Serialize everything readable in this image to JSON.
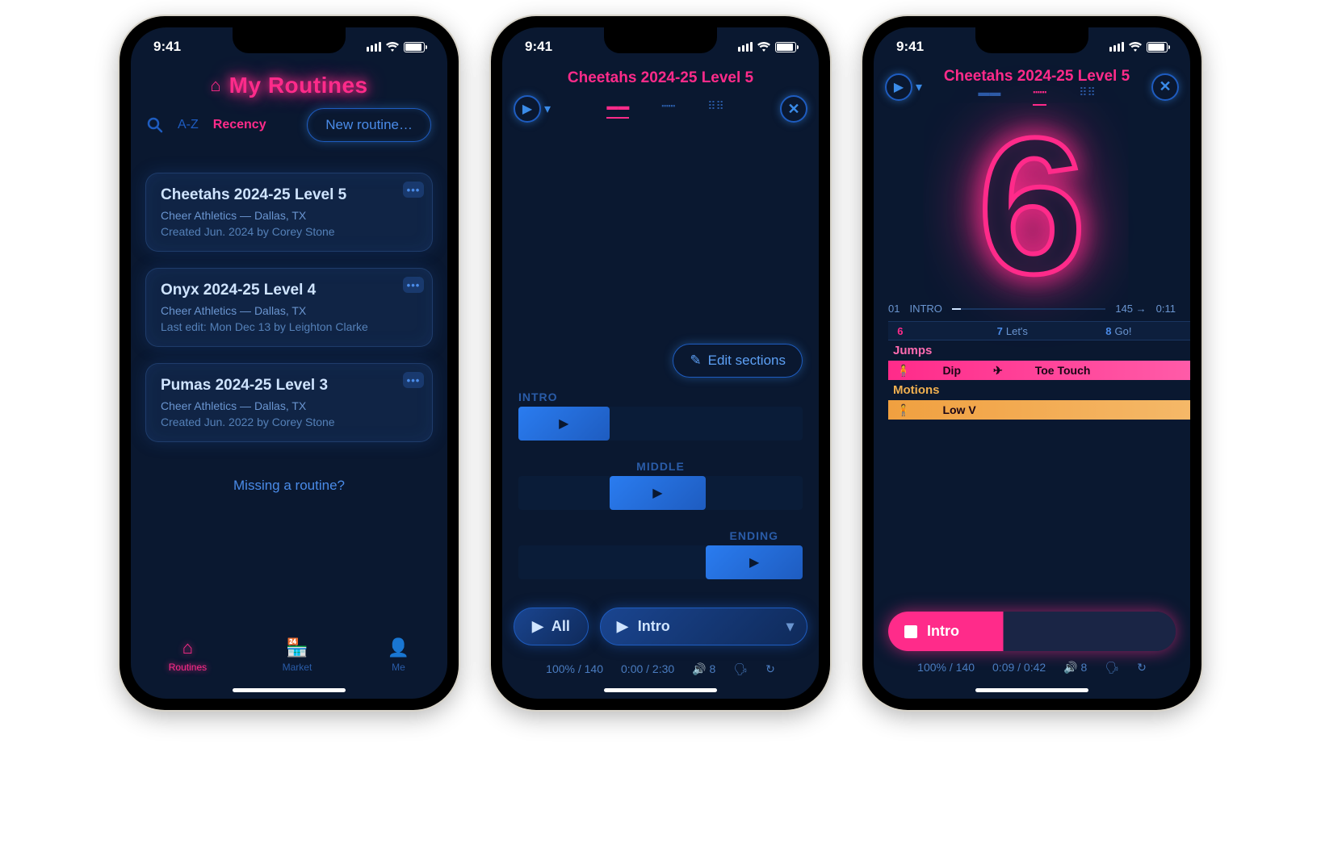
{
  "status": {
    "time": "9:41"
  },
  "phone1": {
    "title": "My Routines",
    "sort_az": "A-Z",
    "sort_recency": "Recency",
    "new_routine": "New routine…",
    "missing": "Missing a routine?",
    "routines": [
      {
        "title": "Cheetahs 2024-25 Level 5",
        "gym": "Cheer Athletics — Dallas, TX",
        "meta": "Created Jun. 2024 by Corey Stone"
      },
      {
        "title": "Onyx 2024-25 Level 4",
        "gym": "Cheer Athletics — Dallas, TX",
        "meta": "Last edit: Mon Dec 13 by Leighton Clarke"
      },
      {
        "title": "Pumas 2024-25 Level 3",
        "gym": "Cheer Athletics — Dallas, TX",
        "meta": "Created Jun. 2022 by Corey Stone"
      }
    ],
    "tabs": {
      "routines": "Routines",
      "market": "Market",
      "me": "Me"
    }
  },
  "phone2": {
    "title": "Cheetahs 2024-25 Level 5",
    "edit_sections": "Edit sections",
    "sections": [
      {
        "name": "INTRO",
        "left": "0%",
        "width": "32%"
      },
      {
        "name": "MIDDLE",
        "left": "32%",
        "width": "34%",
        "label_align": "center"
      },
      {
        "name": "ENDING",
        "left": "66%",
        "width": "34%",
        "label_align": "right"
      }
    ],
    "play_all": "All",
    "play_section": "Intro",
    "stats": {
      "speed_bpm": "100% / 140",
      "time": "0:00 / 2:30",
      "count": "8"
    }
  },
  "phone3": {
    "title": "Cheetahs 2024-25 Level 5",
    "count": "6",
    "progress": {
      "section_num": "01",
      "section_name": "INTRO",
      "bpm": "145 →",
      "elapsed": "0:11"
    },
    "ruler": [
      {
        "n": "6",
        "t": "",
        "pos": "3%",
        "hot": true
      },
      {
        "n": "7",
        "t": "Let's",
        "pos": "36%",
        "hot": false
      },
      {
        "n": "8",
        "t": "Go!",
        "pos": "72%",
        "hot": false
      }
    ],
    "groups": [
      {
        "head": "Jumps",
        "head_class": "pink",
        "track_class": "",
        "items": [
          "Dip",
          "Toe Touch"
        ]
      },
      {
        "head": "Motions",
        "head_class": "",
        "track_class": "orange",
        "items": [
          "Low V"
        ]
      }
    ],
    "now_section": "Intro",
    "stats": {
      "speed_bpm": "100% / 140",
      "time": "0:09 / 0:42",
      "count": "8"
    }
  }
}
